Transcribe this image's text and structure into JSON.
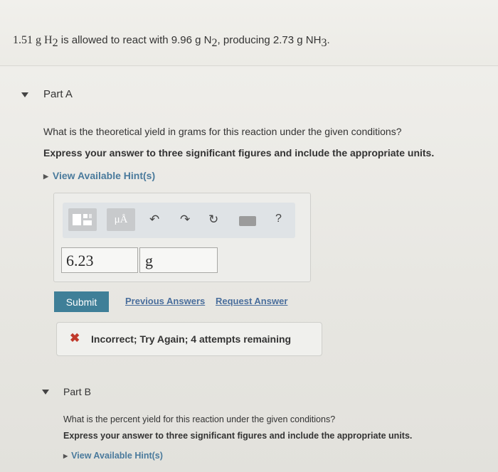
{
  "problem": {
    "prefix": "1.51 g H",
    "h_sub": "2",
    "mid1": " is allowed to react with 9.96 g N",
    "n_sub": "2",
    "mid2": ", producing 2.73 g NH",
    "nh_sub": "3",
    "end": "."
  },
  "part_a": {
    "title": "Part A",
    "question": "What is the theoretical yield in grams for this reaction under the given conditions?",
    "instruction": "Express your answer to three significant figures and include the appropriate units.",
    "hint_label": "View Available Hint(s)",
    "toolbar": {
      "templates_icon": "templates-icon",
      "units_label": "μÅ",
      "undo_icon": "undo-icon",
      "redo_icon": "redo-icon",
      "reset_icon": "reset-icon",
      "keyboard_icon": "keyboard-icon",
      "help_label": "?"
    },
    "value": "6.23",
    "unit": "g",
    "submit_label": "Submit",
    "previous_answers_label": "Previous Answers",
    "request_answer_label": "Request Answer",
    "feedback": {
      "icon": "x-icon",
      "message": "Incorrect; Try Again; 4 attempts remaining",
      "color": "#c0392b"
    }
  },
  "part_b": {
    "title": "Part B",
    "question": "What is the percent yield for this reaction under the given conditions?",
    "instruction": "Express your answer to three significant figures and include the appropriate units.",
    "hint_label": "View Available Hint(s)"
  },
  "colors": {
    "submit": "#3f7f98",
    "link": "#4a6e9c",
    "hint": "#4a7a9c"
  }
}
